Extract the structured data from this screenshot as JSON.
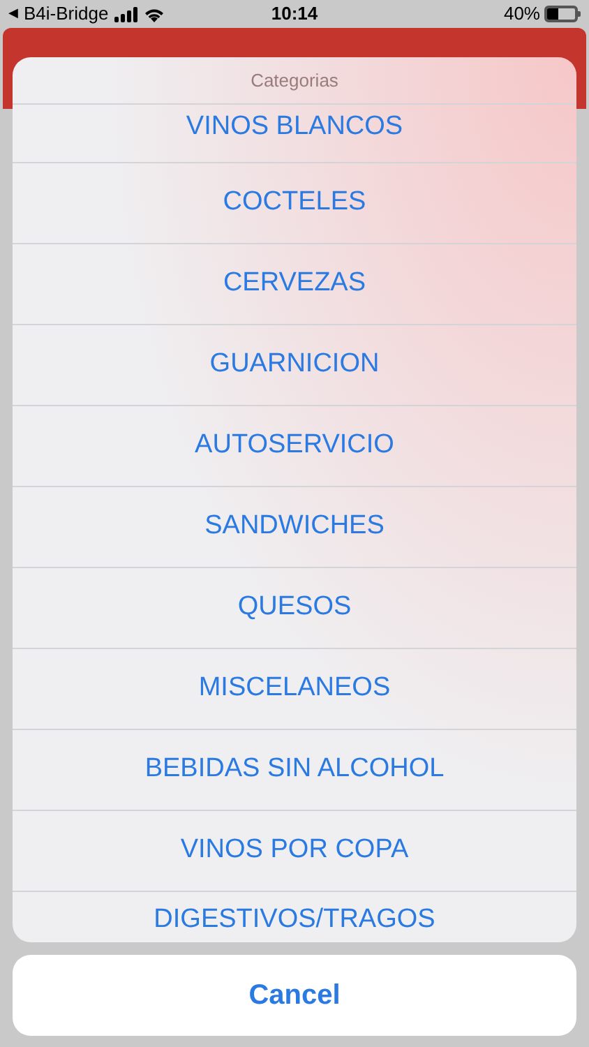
{
  "status_bar": {
    "back_arrow": "◀",
    "back_app": "B4i-Bridge",
    "time": "10:14",
    "battery": {
      "text": "40%",
      "level": 0.4
    }
  },
  "action_sheet": {
    "title": "Categorias",
    "items": [
      {
        "label": "VINOS BLANCOS"
      },
      {
        "label": "COCTELES"
      },
      {
        "label": "CERVEZAS"
      },
      {
        "label": "GUARNICION"
      },
      {
        "label": "AUTOSERVICIO"
      },
      {
        "label": "SANDWICHES"
      },
      {
        "label": "QUESOS"
      },
      {
        "label": "MISCELANEOS"
      },
      {
        "label": "BEBIDAS SIN ALCOHOL"
      },
      {
        "label": "VINOS POR COPA"
      },
      {
        "label": "DIGESTIVOS/TRAGOS"
      }
    ],
    "cancel": "Cancel"
  }
}
